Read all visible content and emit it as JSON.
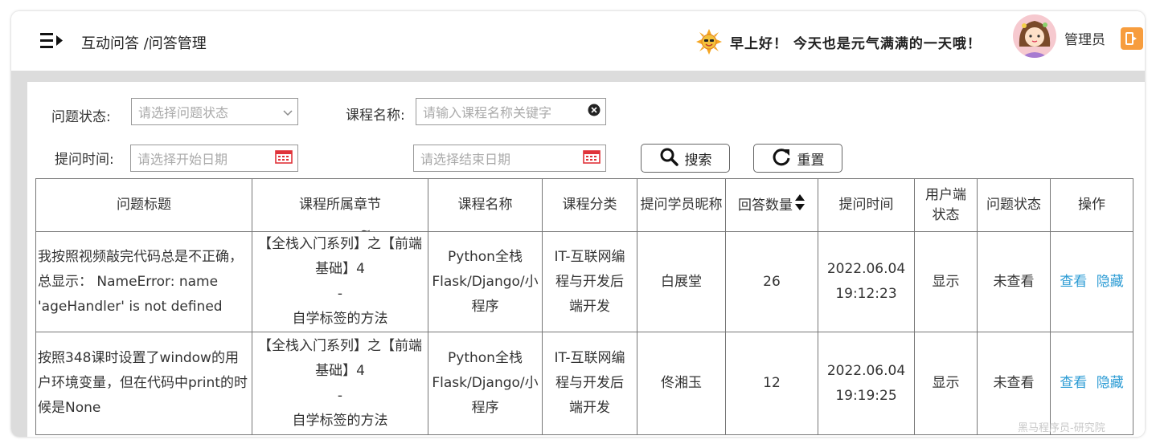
{
  "header": {
    "breadcrumb": "互动问答 /问答管理",
    "greeting": "早上好！ 今天也是元气满满的一天哦！",
    "username": "管理员"
  },
  "filters": {
    "status_label": "问题状态:",
    "status_placeholder": "请选择问题状态",
    "course_label": "课程名称:",
    "course_placeholder": "请输入课程名称关键字",
    "time_label": "提问时间:",
    "start_placeholder": "请选择开始日期",
    "separator": "~",
    "end_placeholder": "请选择结束日期",
    "search_label": "搜索",
    "reset_label": "重置"
  },
  "table": {
    "columns": [
      "问题标题",
      "课程所属章节",
      "课程名称",
      "课程分类",
      "提问学员昵称",
      "回答数量",
      "提问时间",
      "用户端状态",
      "问题状态",
      "操作"
    ],
    "rows": [
      {
        "title": "我按照视频敲完代码总是不正确，总显示： NameError: name 'ageHandler' is not defined",
        "chapter_1": "【全栈入门系列】之【前端基础】4",
        "chapter_dash": "-",
        "chapter_2": "自学标签的方法",
        "course": "Python全栈Flask/Django/小程序",
        "category": "IT-互联网编程与开发后端开发",
        "student": "白展堂",
        "answers": "26",
        "date": "2022.06.04",
        "time": "19:12:23",
        "client_status": "显示",
        "status": "未查看",
        "view": "查看",
        "hide": "隐藏"
      },
      {
        "title": "按照348课时设置了window的用户环境变量，但在代码中print的时候是None",
        "chapter_1": "【全栈入门系列】之【前端基础】4",
        "chapter_dash": "-",
        "chapter_2": "自学标签的方法",
        "course": "Python全栈Flask/Django/小程序",
        "category": "IT-互联网编程与开发后端开发",
        "student": "佟湘玉",
        "answers": "12",
        "date": "2022.06.04",
        "time": "19:19:25",
        "client_status": "显示",
        "status": "未查看",
        "view": "查看",
        "hide": "隐藏"
      }
    ]
  },
  "watermark": "黑马程序员-研究院",
  "icons": {
    "menu": "menu-toggle-icon",
    "sun": "sun-icon",
    "logout": "logout-icon",
    "dropdown": "chevron-down-icon",
    "clear": "clear-icon",
    "calendar": "calendar-icon",
    "search": "search-icon",
    "reset": "refresh-icon",
    "sort": "sort-icon"
  },
  "colors": {
    "link": "#2b9bd4",
    "calendar": "#e0333a",
    "logout": "#f79d3e",
    "frame_gray": "#dcdcdc"
  }
}
